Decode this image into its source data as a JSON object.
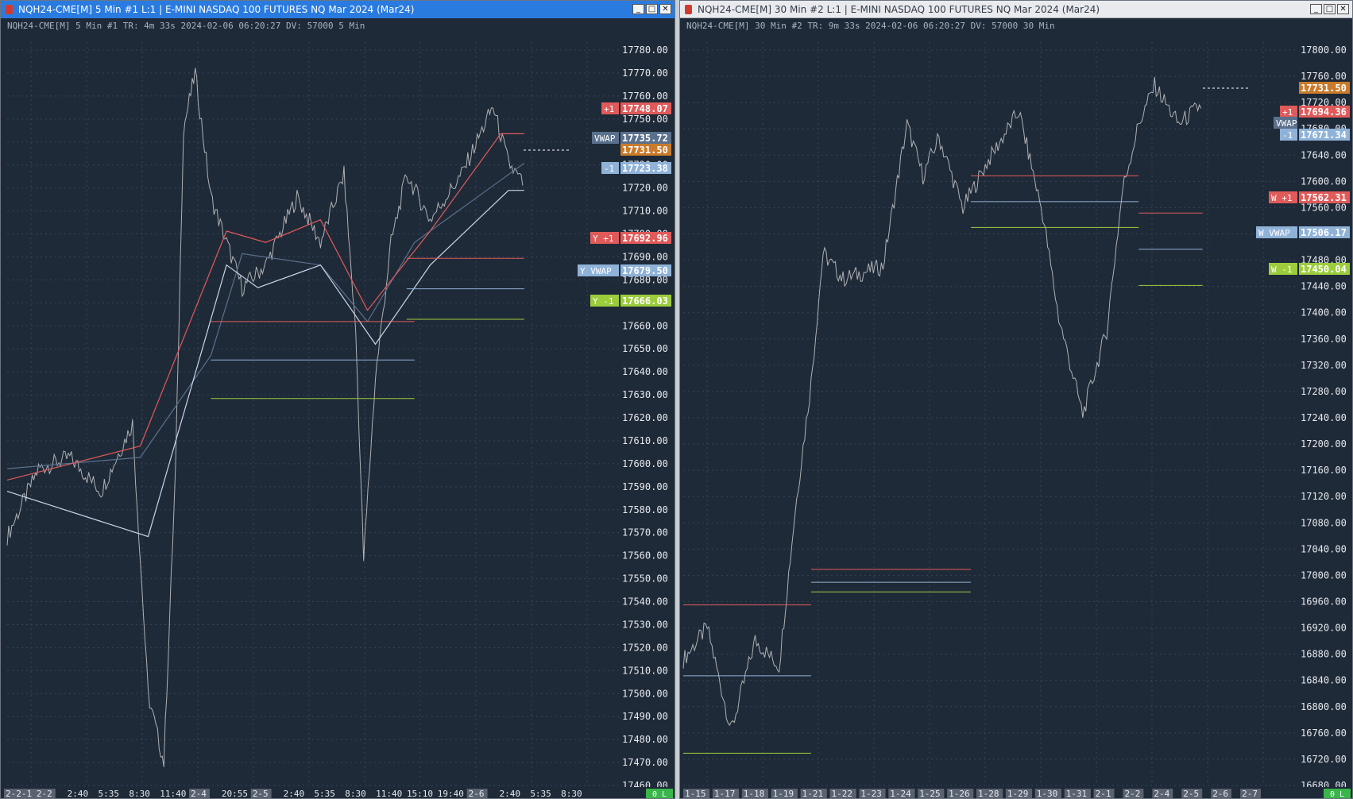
{
  "colors": {
    "bg": "#1f2a38",
    "grid": "#35445a",
    "price": "#c9c9c9",
    "axis_text": "#e6e9ee",
    "info_text": "#aab3bf",
    "red": "#e05a5a",
    "red_label": "#c0392b",
    "blue": "#8fb2d8",
    "blue_label": "#5d84b5",
    "green": "#9ccc3c",
    "green_label": "#62b32a",
    "current_price": "#c97a2a",
    "date_label_bg": "#5a6270",
    "status_ok": "#39b54a",
    "vwap_dark": "#5a708c",
    "vwap_mid": "#8391a3"
  },
  "windows": [
    {
      "title": "NQH24-CME[M]  5 Min  #1 L:1 |  E-MINI NASDAQ 100 FUTURES NQ Mar 2024 (Mar24)",
      "info": "NQH24-CME[M]  5 Min  #1 TR: 4m 33s 2024-02-06 06:20:27 DV: 57000 5 Min",
      "buttons": [
        "_",
        "□",
        "✕"
      ],
      "axis_ticks": [
        "17780.00",
        "17770.00",
        "17760.00",
        "17750.00",
        "17740.00",
        "17730.00",
        "17720.00",
        "17710.00",
        "17700.00",
        "17690.00",
        "17680.00",
        "17670.00",
        "17660.00",
        "17650.00",
        "17640.00",
        "17630.00",
        "17620.00",
        "17610.00",
        "17600.00",
        "17590.00",
        "17580.00",
        "17570.00",
        "17560.00",
        "17550.00",
        "17540.00",
        "17530.00",
        "17520.00",
        "17510.00",
        "17500.00",
        "17490.00",
        "17480.00",
        "17470.00",
        "17460.00"
      ],
      "labels": [
        {
          "tag": "+1",
          "value": "17748.07"
        },
        {
          "tag": "VWAP",
          "value": "17735.72"
        },
        {
          "tag": "",
          "value": "17731.50"
        },
        {
          "tag": "-1",
          "value": "17723.38"
        },
        {
          "tag": "Y +1",
          "value": "17692.96"
        },
        {
          "tag": "Y VWAP",
          "value": "17679.50"
        },
        {
          "tag": "Y -1",
          "value": "17666.03"
        }
      ],
      "date_axis": [
        {
          "text": "2-2-1",
          "boxed": true
        },
        {
          "text": "2-2",
          "boxed": true
        },
        {
          "text": "2:40",
          "boxed": false
        },
        {
          "text": "5:35",
          "boxed": false
        },
        {
          "text": "8:30",
          "boxed": false
        },
        {
          "text": "11:40",
          "boxed": false
        },
        {
          "text": "2-4",
          "boxed": true
        },
        {
          "text": "20:55",
          "boxed": false
        },
        {
          "text": "2-5",
          "boxed": true
        },
        {
          "text": "2:40",
          "boxed": false
        },
        {
          "text": "5:35",
          "boxed": false
        },
        {
          "text": "8:30",
          "boxed": false
        },
        {
          "text": "11:40",
          "boxed": false
        },
        {
          "text": "15:10",
          "boxed": false
        },
        {
          "text": "19:40",
          "boxed": false
        },
        {
          "text": "2-6",
          "boxed": true
        },
        {
          "text": "2:40",
          "boxed": false
        },
        {
          "text": "5:35",
          "boxed": false
        },
        {
          "text": "8:30",
          "boxed": false
        }
      ],
      "status": "0 L"
    },
    {
      "title": "NQH24-CME[M]  30 Min  #2 L:1 |  E-MINI NASDAQ 100 FUTURES NQ Mar 2024 (Mar24)",
      "info": "NQH24-CME[M]  30 Min  #2 TR: 9m 33s 2024-02-06 06:20:27 DV: 57000 30 Min",
      "buttons": [
        "_",
        "□",
        "✕"
      ],
      "axis_ticks": [
        "17800.00",
        "17760.00",
        "17720.00",
        "17680.00",
        "17640.00",
        "17600.00",
        "17560.00",
        "17520.00",
        "17480.00",
        "17440.00",
        "17400.00",
        "17360.00",
        "17320.00",
        "17280.00",
        "17240.00",
        "17200.00",
        "17160.00",
        "17120.00",
        "17080.00",
        "17040.00",
        "17000.00",
        "16960.00",
        "16920.00",
        "16880.00",
        "16840.00",
        "16800.00",
        "16760.00",
        "16720.00",
        "16680.00"
      ],
      "labels": [
        {
          "tag": "",
          "value": "17731.50"
        },
        {
          "tag": "+1",
          "value": "17694.36"
        },
        {
          "tag": "VWAP",
          "value": ""
        },
        {
          "tag": "-1",
          "value": "17671.34"
        },
        {
          "tag": "W +1",
          "value": "17562.31"
        },
        {
          "tag": "W VWAP",
          "value": "17506.17"
        },
        {
          "tag": "W -1",
          "value": "17450.04"
        }
      ],
      "date_axis": [
        {
          "text": "1-15",
          "boxed": true
        },
        {
          "text": "1-17",
          "boxed": true
        },
        {
          "text": "1-18",
          "boxed": true
        },
        {
          "text": "1-19",
          "boxed": true
        },
        {
          "text": "1-21",
          "boxed": true
        },
        {
          "text": "1-22",
          "boxed": true
        },
        {
          "text": "1-23",
          "boxed": true
        },
        {
          "text": "1-24",
          "boxed": true
        },
        {
          "text": "1-25",
          "boxed": true
        },
        {
          "text": "1-26",
          "boxed": true
        },
        {
          "text": "1-28",
          "boxed": true
        },
        {
          "text": "1-29",
          "boxed": true
        },
        {
          "text": "1-30",
          "boxed": true
        },
        {
          "text": "1-31",
          "boxed": true
        },
        {
          "text": "2-1",
          "boxed": true
        },
        {
          "text": "2-2",
          "boxed": true
        },
        {
          "text": "2-4",
          "boxed": true
        },
        {
          "text": "2-5",
          "boxed": true
        },
        {
          "text": "2-6",
          "boxed": true
        },
        {
          "text": "2-7",
          "boxed": true
        }
      ],
      "status": "0 L"
    }
  ],
  "chart_data": [
    {
      "type": "line",
      "ylim": [
        17460,
        17785
      ],
      "series": [
        {
          "name": "Price",
          "values": [
            [
              0,
              17570
            ],
            [
              40,
              17600
            ],
            [
              80,
              17605
            ],
            [
              120,
              17590
            ],
            [
              160,
              17620
            ],
            [
              180,
              17500
            ],
            [
              200,
              17470
            ],
            [
              215,
              17600
            ],
            [
              225,
              17750
            ],
            [
              240,
              17775
            ],
            [
              260,
              17720
            ],
            [
              280,
              17700
            ],
            [
              300,
              17680
            ],
            [
              330,
              17690
            ],
            [
              370,
              17720
            ],
            [
              400,
              17700
            ],
            [
              430,
              17730
            ],
            [
              445,
              17660
            ],
            [
              455,
              17560
            ],
            [
              470,
              17640
            ],
            [
              490,
              17700
            ],
            [
              510,
              17730
            ],
            [
              540,
              17710
            ],
            [
              580,
              17730
            ],
            [
              620,
              17760
            ],
            [
              640,
              17735
            ],
            [
              660,
              17725
            ]
          ]
        },
        {
          "name": "VWAP",
          "values": [
            [
              0,
              17600
            ],
            [
              170,
              17605
            ],
            [
              260,
              17650
            ],
            [
              300,
              17695
            ],
            [
              400,
              17690
            ],
            [
              460,
              17665
            ],
            [
              520,
              17700
            ],
            [
              600,
              17720
            ],
            [
              660,
              17735
            ]
          ]
        },
        {
          "name": "+1",
          "values": [
            [
              0,
              17595
            ],
            [
              170,
              17610
            ],
            [
              280,
              17705
            ],
            [
              330,
              17700
            ],
            [
              400,
              17710
            ],
            [
              460,
              17670
            ],
            [
              540,
              17705
            ],
            [
              630,
              17748
            ],
            [
              660,
              17748
            ]
          ]
        },
        {
          "name": "-1",
          "values": [
            [
              0,
              17590
            ],
            [
              180,
              17570
            ],
            [
              280,
              17690
            ],
            [
              320,
              17680
            ],
            [
              400,
              17690
            ],
            [
              470,
              17655
            ],
            [
              540,
              17690
            ],
            [
              640,
              17723
            ],
            [
              660,
              17723
            ]
          ]
        },
        {
          "name": "Y +1",
          "values": [
            [
              510,
              17692.96
            ],
            [
              660,
              17692.96
            ]
          ]
        },
        {
          "name": "Y VWAP",
          "values": [
            [
              510,
              17679.5
            ],
            [
              660,
              17679.5
            ]
          ]
        },
        {
          "name": "Y -1",
          "values": [
            [
              510,
              17666.03
            ],
            [
              660,
              17666.03
            ]
          ]
        },
        {
          "name": "prior high",
          "values": [
            [
              260,
              17665
            ],
            [
              520,
              17665
            ]
          ]
        },
        {
          "name": "prior VWAP",
          "values": [
            [
              260,
              17648
            ],
            [
              520,
              17648
            ]
          ]
        },
        {
          "name": "prior low",
          "values": [
            [
              260,
              17631
            ],
            [
              520,
              17631
            ]
          ]
        }
      ]
    },
    {
      "type": "line",
      "ylim": [
        16675,
        17815
      ],
      "series": [
        {
          "name": "Price",
          "values": [
            [
              0,
              16870
            ],
            [
              30,
              16920
            ],
            [
              60,
              16760
            ],
            [
              90,
              16900
            ],
            [
              120,
              16860
            ],
            [
              140,
              17100
            ],
            [
              160,
              17300
            ],
            [
              175,
              17500
            ],
            [
              200,
              17460
            ],
            [
              250,
              17480
            ],
            [
              280,
              17700
            ],
            [
              300,
              17620
            ],
            [
              320,
              17680
            ],
            [
              350,
              17570
            ],
            [
              380,
              17640
            ],
            [
              420,
              17720
            ],
            [
              450,
              17560
            ],
            [
              470,
              17400
            ],
            [
              500,
              17250
            ],
            [
              530,
              17380
            ],
            [
              550,
              17600
            ],
            [
              570,
              17700
            ],
            [
              590,
              17760
            ],
            [
              620,
              17700
            ],
            [
              650,
              17731.5
            ]
          ]
        },
        {
          "name": "W +1",
          "values": [
            [
              570,
              17562.31
            ],
            [
              650,
              17562.31
            ]
          ]
        },
        {
          "name": "W VWAP",
          "values": [
            [
              570,
              17506.17
            ],
            [
              650,
              17506.17
            ]
          ]
        },
        {
          "name": "W -1",
          "values": [
            [
              570,
              17450.04
            ],
            [
              650,
              17450.04
            ]
          ]
        },
        {
          "name": "Wk2 +1",
          "values": [
            [
              360,
              17620
            ],
            [
              570,
              17620
            ]
          ]
        },
        {
          "name": "Wk2 VWAP",
          "values": [
            [
              360,
              17580
            ],
            [
              570,
              17580
            ]
          ]
        },
        {
          "name": "Wk2 -1",
          "values": [
            [
              360,
              17540
            ],
            [
              570,
              17540
            ]
          ]
        },
        {
          "name": "Wk1 +1",
          "values": [
            [
              160,
              17010
            ],
            [
              360,
              17010
            ]
          ]
        },
        {
          "name": "Wk1 VWAP",
          "values": [
            [
              160,
              16990
            ],
            [
              360,
              16990
            ]
          ]
        },
        {
          "name": "Wk1 -1",
          "values": [
            [
              160,
              16975
            ],
            [
              360,
              16975
            ]
          ]
        },
        {
          "name": "Wk0 +1",
          "values": [
            [
              0,
              16955
            ],
            [
              160,
              16955
            ]
          ]
        },
        {
          "name": "Wk0 VWAP",
          "values": [
            [
              0,
              16845
            ],
            [
              160,
              16845
            ]
          ]
        },
        {
          "name": "Wk0 -1",
          "values": [
            [
              0,
              16725
            ],
            [
              160,
              16725
            ]
          ]
        }
      ]
    }
  ]
}
